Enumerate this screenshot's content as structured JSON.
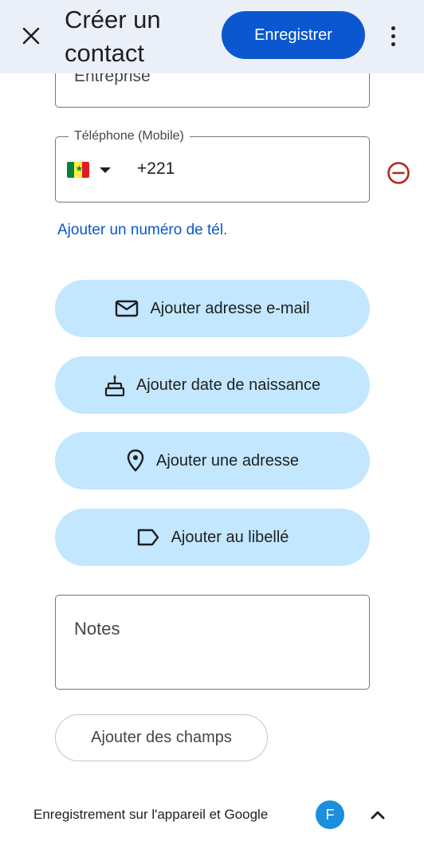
{
  "header": {
    "title": "Créer un contact",
    "save_label": "Enregistrer",
    "close_icon": "close-icon",
    "more_icon": "more-vert-icon"
  },
  "form": {
    "company_label": "Entreprise",
    "phone": {
      "legend": "Téléphone (Mobile)",
      "country_flag": "senegal-flag-icon",
      "value": "+221"
    },
    "add_phone_link": "Ajouter un numéro de tél.",
    "actions": [
      {
        "label": "Ajouter adresse e-mail",
        "icon": "mail-icon"
      },
      {
        "label": "Ajouter date de naissance",
        "icon": "cake-icon"
      },
      {
        "label": "Ajouter une adresse",
        "icon": "location-pin-icon"
      },
      {
        "label": "Ajouter au libellé",
        "icon": "label-icon"
      }
    ],
    "notes_label": "Notes",
    "add_fields_label": "Ajouter des champs"
  },
  "footer": {
    "save_location_text": "Enregistrement sur l'appareil et Google",
    "avatar_initial": "F"
  },
  "colors": {
    "header_bg": "#ebf0f8",
    "primary": "#0b57d0",
    "pill_bg": "#c2e7ff",
    "remove_icon": "#b3261e",
    "avatar_bg": "#1a8fdd"
  }
}
